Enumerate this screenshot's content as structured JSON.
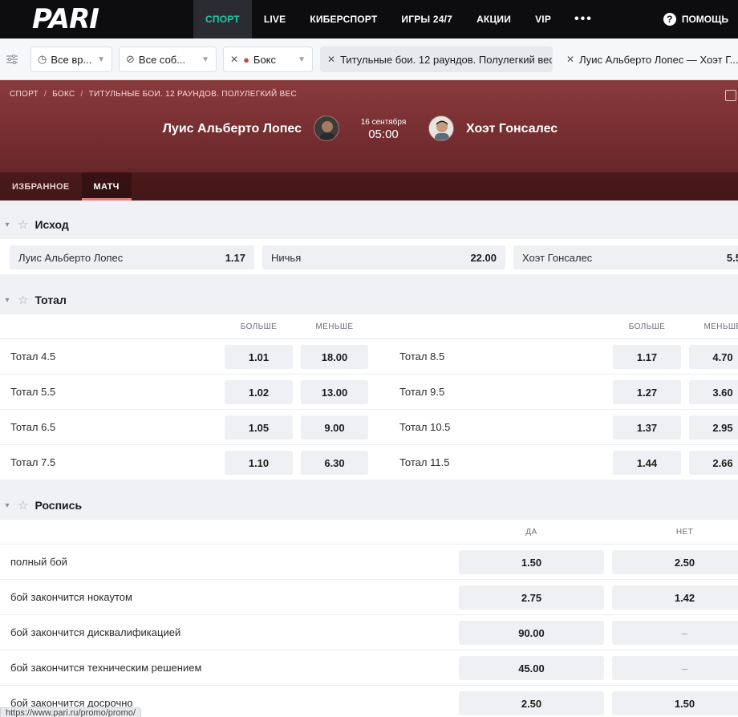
{
  "nav": {
    "logo": "PARI",
    "items": [
      "Спорт",
      "Live",
      "Киберспорт",
      "Игры 24/7",
      "Акции",
      "VIP"
    ],
    "more": "•••",
    "help": "Помощь"
  },
  "filters": {
    "time": "Все вр...",
    "events": "Все соб...",
    "sport": "Бокс",
    "tournament": "Титульные бои. 12 раундов. Полулегкий вес",
    "match": "Луис Альберто Лопес — Хоэт Г..."
  },
  "header": {
    "breadcrumb": [
      "Спорт",
      "Бокс",
      "Титульные бои. 12 раундов. Полулегкий вес"
    ],
    "team1": "Луис Альберто Лопес",
    "team2": "Хоэт Гонсалес",
    "date": "16 сентября",
    "time": "05:00",
    "tabs": [
      "Избранное",
      "Матч"
    ]
  },
  "outcome": {
    "title": "Исход",
    "items": [
      {
        "label": "Луис Альберто Лопес",
        "value": "1.17"
      },
      {
        "label": "Ничья",
        "value": "22.00"
      },
      {
        "label": "Хоэт Гонсалес",
        "value": "5.5"
      }
    ]
  },
  "total": {
    "title": "Тотал",
    "over": "Больше",
    "under": "Меньше",
    "left": [
      {
        "label": "Тотал 4.5",
        "over": "1.01",
        "under": "18.00"
      },
      {
        "label": "Тотал 5.5",
        "over": "1.02",
        "under": "13.00"
      },
      {
        "label": "Тотал 6.5",
        "over": "1.05",
        "under": "9.00"
      },
      {
        "label": "Тотал 7.5",
        "over": "1.10",
        "under": "6.30"
      }
    ],
    "right": [
      {
        "label": "Тотал 8.5",
        "over": "1.17",
        "under": "4.70"
      },
      {
        "label": "Тотал 9.5",
        "over": "1.27",
        "under": "3.60"
      },
      {
        "label": "Тотал 10.5",
        "over": "1.37",
        "under": "2.95"
      },
      {
        "label": "Тотал 11.5",
        "over": "1.44",
        "under": "2.66"
      }
    ]
  },
  "card": {
    "title": "Роспись",
    "yes": "Да",
    "no": "Нет",
    "rows": [
      {
        "label": "полный бой",
        "yes": "1.50",
        "no": "2.50"
      },
      {
        "label": "бой закончится нокаутом",
        "yes": "2.75",
        "no": "1.42"
      },
      {
        "label": "бой закончится дисквалификацией",
        "yes": "90.00",
        "no": "–"
      },
      {
        "label": "бой закончится техническим решением",
        "yes": "45.00",
        "no": "–"
      },
      {
        "label": "бой закончится досрочно",
        "yes": "2.50",
        "no": "1.50"
      }
    ]
  },
  "status_url": "https://www.pari.ru/promo/promo/",
  "colors": {
    "accent": "#21c7a8",
    "banner": "#7a3033",
    "nav_bg": "#0d0d10"
  }
}
